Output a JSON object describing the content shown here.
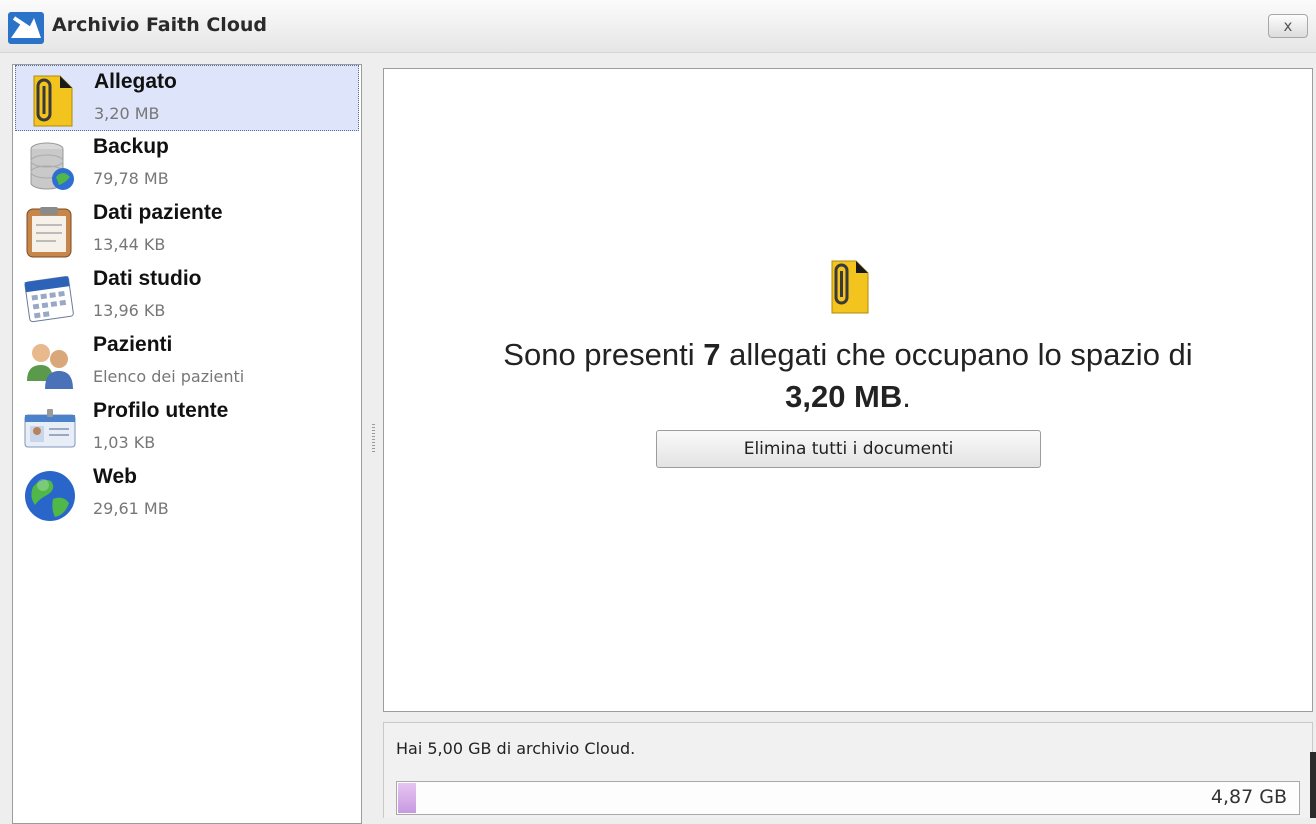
{
  "window": {
    "title": "Archivio Faith Cloud",
    "close_label": "x"
  },
  "sidebar": {
    "items": [
      {
        "label": "Allegato",
        "sub": "3,20 MB",
        "icon": "paperclip-document-icon",
        "selected": true
      },
      {
        "label": "Backup",
        "sub": "79,78 MB",
        "icon": "database-globe-icon"
      },
      {
        "label": "Dati paziente",
        "sub": "13,44 KB",
        "icon": "clipboard-icon"
      },
      {
        "label": "Dati studio",
        "sub": "13,96 KB",
        "icon": "calendar-icon"
      },
      {
        "label": "Pazienti",
        "sub": "Elenco dei pazienti",
        "icon": "users-icon"
      },
      {
        "label": "Profilo utente",
        "sub": "1,03 KB",
        "icon": "id-card-icon"
      },
      {
        "label": "Web",
        "sub": "29,61 MB",
        "icon": "globe-icon"
      }
    ]
  },
  "main": {
    "icon": "paperclip-document-icon",
    "msg_prefix": "Sono presenti ",
    "count": "7",
    "msg_middle": " allegati che occupano lo spazio di",
    "size": "3,20 MB",
    "msg_suffix": ".",
    "delete_button": "Elimina tutti i documenti"
  },
  "storage": {
    "text": "Hai 5,00 GB di archivio Cloud.",
    "remaining_label": "4,87 GB",
    "used_fraction": 0.02
  },
  "colors": {
    "selected_bg": "#dee4f9",
    "progress_fill": "#d2a8e8",
    "icon_yellow": "#f3c41d"
  }
}
